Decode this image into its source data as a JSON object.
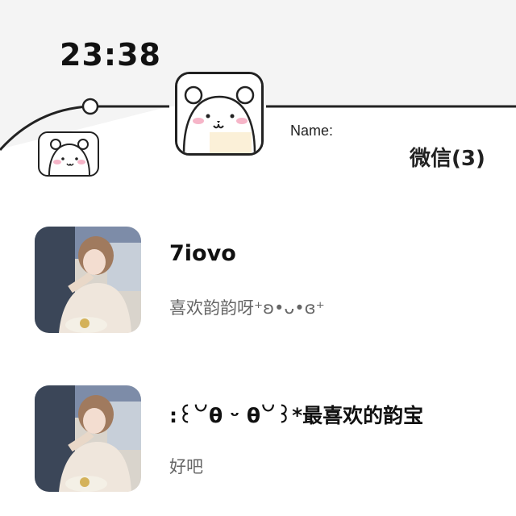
{
  "status_bar": {
    "time": "23:38"
  },
  "profile": {
    "name_label": "Name:"
  },
  "header": {
    "title": "微信(3)"
  },
  "chats": [
    {
      "name": "7iovo",
      "preview": "喜欢韵韵呀⁺ʚ•ᴗ•ɞ⁺"
    },
    {
      "name": ":꒰꒡θ ᵕ θ꒡꒱*最喜欢的韵宝",
      "preview": "好吧"
    }
  ],
  "colors": {
    "outline": "#222222",
    "header_fill": "#f4f4f4",
    "blush": "#f6b5c8"
  }
}
